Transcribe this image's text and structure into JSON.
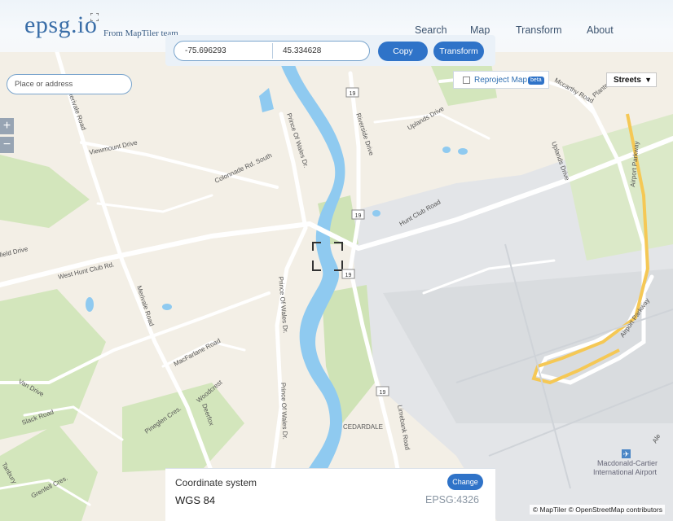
{
  "header": {
    "logo": "epsg.io",
    "tagline": "From MapTiler team",
    "nav": [
      "Search",
      "Map",
      "Transform",
      "About"
    ]
  },
  "coords": {
    "lon": "-75.696293",
    "lat": "45.334628",
    "copy_label": "Copy",
    "transform_label": "Transform"
  },
  "search": {
    "placeholder": "Place or address"
  },
  "zoom": {
    "in": "+",
    "out": "−"
  },
  "reproject": {
    "label": "Reproject Map",
    "badge": "beta"
  },
  "layer": {
    "selected": "Streets"
  },
  "crs_panel": {
    "title": "Coordinate system",
    "name": "WGS 84",
    "code": "EPSG:4326",
    "change_label": "Change"
  },
  "attribution": "© MapTiler © OpenStreetMap contributors",
  "map_labels": {
    "rd_merivale_n": "Merivale Road",
    "rd_viewmount": "Viewmount Drive",
    "rd_colonnade": "Colonnade Rd. South",
    "rd_prince_wales_n": "Prince Of Wales Dr.",
    "rd_riverside": "Riverside Drive",
    "rd_uplands": "Uplands Drive",
    "rd_mccarthy": "Mccarthy Road",
    "rd_plante": "Plante",
    "rd_airport_pkwy_n": "Airport Parkway",
    "rd_uplands_dr": "Uplands Drive",
    "rd_hunt_club": "Hunt Club Road",
    "rd_west_hunt_club": "West Hunt Club Rd.",
    "rd_field": "field Drive",
    "rd_merivale_s": "Merivale Road",
    "rd_prince_wales_s": "Prince Of Wales Dr.",
    "rd_prince_wales_s2": "Prince Of Wales Dr.",
    "rd_macfarlane": "MacFarlane Road",
    "rd_airport_pkwy_s": "Airport Parkway",
    "rd_van": "Van Drive",
    "rd_slack": "Slack Road",
    "rd_woodcrest": "Woodcrest",
    "rd_deerfox": "Deerfox",
    "rd_pineglen": "Pineglen Cres.",
    "rd_grenfell": "Grenfell Cres.",
    "rd_tanbury": "Tanbury",
    "rd_limebank": "Limebank Road",
    "place_cedardale": "CEDARDALE",
    "place_airport_1": "Macdonald-Cartier",
    "place_airport_2": "International Airport",
    "rd_ale": "Ale",
    "shield_19": "19"
  },
  "colors": {
    "land": "#f3efe6",
    "park": "#cfe3b6",
    "water": "#8fcaf0",
    "road": "#ffffff",
    "airport": "#e2e4e7",
    "accent": "#2f73c8"
  }
}
